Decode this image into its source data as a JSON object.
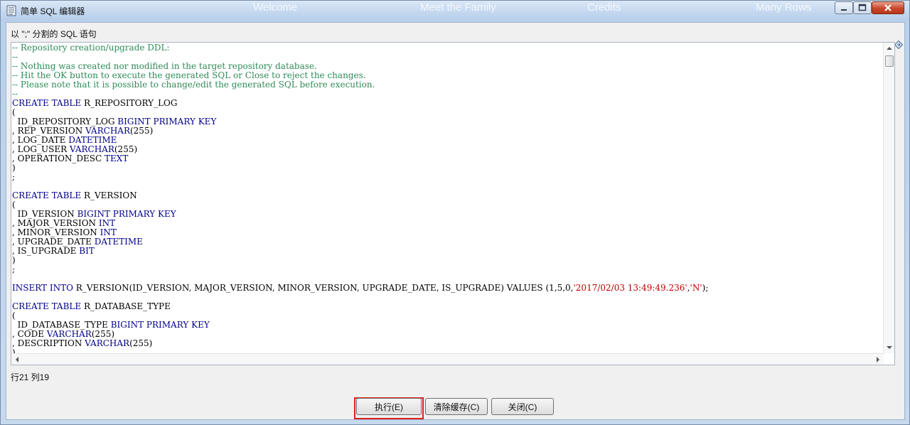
{
  "window": {
    "title": "简单 SQL 编辑器",
    "background_tabs": [
      "Welcome",
      "Meet the Family",
      "Credits",
      "Many Rows"
    ]
  },
  "hint": "以 \";\" 分割的 SQL 语句",
  "code_lines": [
    [
      {
        "t": "-- Repository creation/upgrade DDL:",
        "c": "c"
      }
    ],
    [
      {
        "t": "--",
        "c": "c"
      }
    ],
    [
      {
        "t": "-- Nothing was created nor modified in the target repository database.",
        "c": "c"
      }
    ],
    [
      {
        "t": "-- Hit the OK button to execute the generated SQL or Close to reject the changes.",
        "c": "c"
      }
    ],
    [
      {
        "t": "-- Please note that it is possible to change/edit the generated SQL before execution.",
        "c": "c"
      }
    ],
    [
      {
        "t": "--",
        "c": "c"
      }
    ],
    [
      {
        "t": "CREATE",
        "c": "k"
      },
      {
        "t": " "
      },
      {
        "t": "TABLE",
        "c": "k"
      },
      {
        "t": " R_REPOSITORY_LOG"
      }
    ],
    [
      {
        "t": "("
      }
    ],
    [
      {
        "t": "  ID_REPOSITORY_LOG "
      },
      {
        "t": "BIGINT",
        "c": "k"
      },
      {
        "t": " "
      },
      {
        "t": "PRIMARY KEY",
        "c": "k"
      }
    ],
    [
      {
        "t": ", REP_VERSION "
      },
      {
        "t": "VARCHAR",
        "c": "k"
      },
      {
        "t": "(255)"
      }
    ],
    [
      {
        "t": ", LOG_DATE "
      },
      {
        "t": "DATETIME",
        "c": "k"
      }
    ],
    [
      {
        "t": ", LOG_USER "
      },
      {
        "t": "VARCHAR",
        "c": "k"
      },
      {
        "t": "(255)"
      }
    ],
    [
      {
        "t": ", OPERATION_DESC "
      },
      {
        "t": "TEXT",
        "c": "k"
      }
    ],
    [
      {
        "t": ")"
      }
    ],
    [
      {
        "t": ";"
      }
    ],
    [
      {
        "t": ""
      }
    ],
    [
      {
        "t": "CREATE",
        "c": "k"
      },
      {
        "t": " "
      },
      {
        "t": "TABLE",
        "c": "k"
      },
      {
        "t": " R_VERSION"
      }
    ],
    [
      {
        "t": "("
      }
    ],
    [
      {
        "t": "  ID_VERSION "
      },
      {
        "t": "BIGINT",
        "c": "k"
      },
      {
        "t": " "
      },
      {
        "t": "PRIMARY KEY",
        "c": "k"
      }
    ],
    [
      {
        "t": ", MAJOR_VERSION "
      },
      {
        "t": "INT",
        "c": "k"
      }
    ],
    [
      {
        "t": ", MINOR_VERSION "
      },
      {
        "t": "INT",
        "c": "k"
      }
    ],
    [
      {
        "t": ", UPGRADE_DATE "
      },
      {
        "t": "DATETIME",
        "c": "k"
      }
    ],
    [
      {
        "t": ", IS_UPGRADE "
      },
      {
        "t": "BIT",
        "c": "k"
      }
    ],
    [
      {
        "t": ")"
      }
    ],
    [
      {
        "t": ";"
      }
    ],
    [
      {
        "t": ""
      }
    ],
    [
      {
        "t": "INSERT",
        "c": "k"
      },
      {
        "t": " "
      },
      {
        "t": "INTO",
        "c": "k"
      },
      {
        "t": " R_VERSION(ID_VERSION, MAJOR_VERSION, MINOR_VERSION, UPGRADE_DATE, IS_UPGRADE) VALUES (1,5,0,"
      },
      {
        "t": "'2017/02/03 13:49:49.236'",
        "c": "s"
      },
      {
        "t": ","
      },
      {
        "t": "'N'",
        "c": "s"
      },
      {
        "t": ");"
      }
    ],
    [
      {
        "t": ""
      }
    ],
    [
      {
        "t": "CREATE",
        "c": "k"
      },
      {
        "t": " "
      },
      {
        "t": "TABLE",
        "c": "k"
      },
      {
        "t": " R_DATABASE_TYPE"
      }
    ],
    [
      {
        "t": "("
      }
    ],
    [
      {
        "t": "  ID_DATABASE_TYPE "
      },
      {
        "t": "BIGINT",
        "c": "k"
      },
      {
        "t": " "
      },
      {
        "t": "PRIMARY KEY",
        "c": "k"
      }
    ],
    [
      {
        "t": ", CODE "
      },
      {
        "t": "VARCHAR",
        "c": "k"
      },
      {
        "t": "(255)"
      }
    ],
    [
      {
        "t": ", DESCRIPTION "
      },
      {
        "t": "VARCHAR",
        "c": "k"
      },
      {
        "t": "(255)"
      }
    ],
    [
      {
        "t": ")"
      }
    ]
  ],
  "status": "行21 列19",
  "buttons": {
    "execute": "执行(E)",
    "clear_cache": "清除缓存(C)",
    "close": "关闭(C)"
  },
  "colors": {
    "comment": "#2e8b57",
    "keyword": "#00008b",
    "string": "#c00000",
    "highlight": "#e02020"
  },
  "icons": [
    "document-icon",
    "minimize-icon",
    "maximize-icon",
    "close-icon",
    "diamond-icon"
  ]
}
